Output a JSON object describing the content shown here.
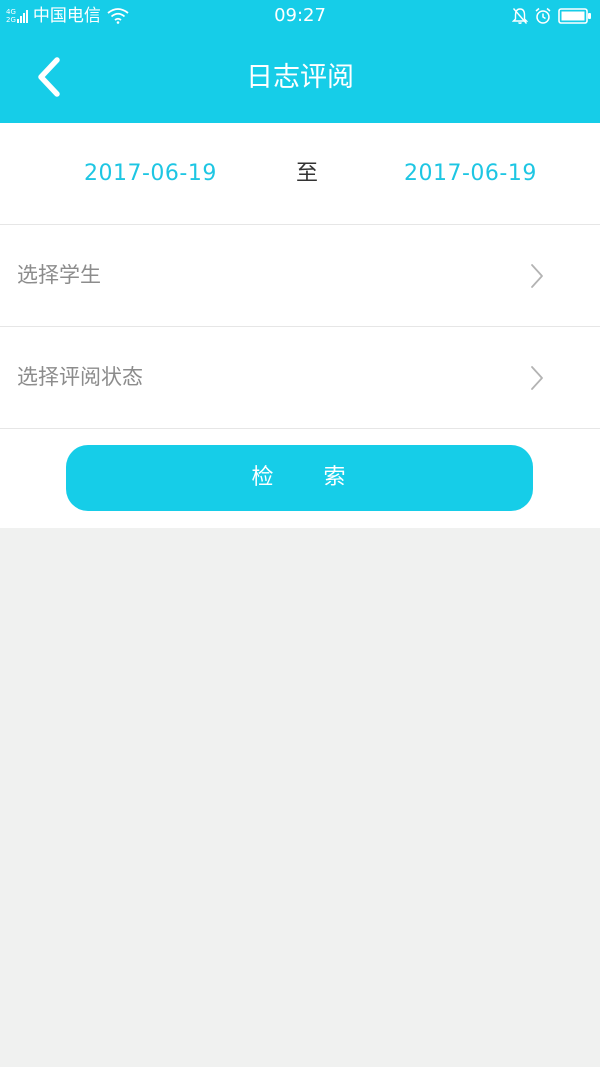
{
  "status_bar": {
    "network_top": "4G",
    "network_bottom": "2G",
    "carrier": "中国电信",
    "time": "09:27",
    "icons": [
      "signal-icon",
      "wifi-icon",
      "bell-muted-icon",
      "alarm-icon",
      "battery-icon"
    ]
  },
  "header": {
    "title": "日志评阅",
    "back_icon": "chevron-left-icon"
  },
  "date_range": {
    "start": "2017-06-19",
    "separator": "至",
    "end": "2017-06-19"
  },
  "filters": {
    "student_label": "选择学生",
    "status_label": "选择评阅状态",
    "chevron_icon": "chevron-right-icon"
  },
  "search_button": {
    "label": "检　　索"
  },
  "colors": {
    "accent": "#16cde8",
    "date_text": "#1ec6e3",
    "label_text": "#8c8c8c",
    "background": "#f0f1f0"
  }
}
